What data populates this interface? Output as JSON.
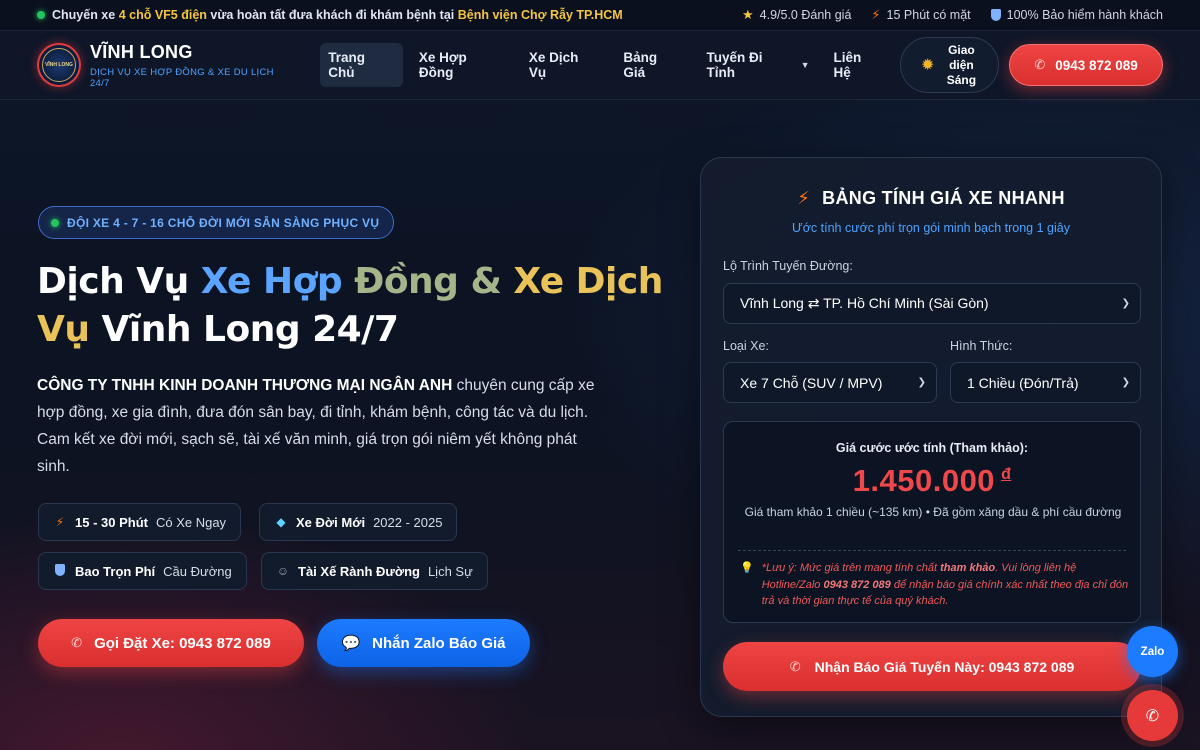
{
  "topbar": {
    "news_prefix": "Chuyến xe",
    "news_hl1": "4 chỗ VF5 điện",
    "news_mid": "vừa hoàn tất đưa khách đi khám bệnh tại",
    "news_hl2": "Bệnh viện Chợ Rẫy TP.HCM",
    "stats": [
      {
        "icon": "star-icon",
        "text": "4.9/5.0 Đánh giá"
      },
      {
        "icon": "bolt-icon",
        "text": "15 Phút có mặt"
      },
      {
        "icon": "shield-icon",
        "text": "100% Bảo hiểm hành khách"
      }
    ]
  },
  "header": {
    "logo_text": "VĨNH LONG",
    "brand_name": "VĨNH LONG",
    "brand_tagline": "DỊCH VỤ XE HỢP ĐỒNG & XE DU LỊCH 24/7",
    "nav": [
      {
        "label": "Trang Chủ",
        "active": true
      },
      {
        "label": "Xe Hợp Đồng"
      },
      {
        "label": "Xe Dịch Vụ"
      },
      {
        "label": "Bảng Giá"
      },
      {
        "label": "Tuyến Đi Tỉnh",
        "dropdown": true
      },
      {
        "label": "Liên Hệ"
      }
    ],
    "theme_toggle": "Giao diện Sáng",
    "phone": "0943 872 089"
  },
  "hero": {
    "badge": "ĐỘI XE 4 - 7 - 16 CHỖ ĐỜI MỚI SẴN SÀNG PHỤC VỤ",
    "title_1": "Dịch Vụ ",
    "title_2": "Xe Hợp",
    "title_3": " Đồng",
    "title_4": " & ",
    "title_5": "Xe Dịch",
    "title_6": "Vụ",
    "title_7": " Vĩnh Long 24/7",
    "company": "CÔNG TY TNHH KINH DOANH THƯƠNG MẠI NGÂN ANH",
    "description": " chuyên cung cấp xe hợp đồng, xe gia đình, đưa đón sân bay, đi tỉnh, khám bệnh, công tác và du lịch. Cam kết xe đời mới, sạch sẽ, tài xế văn minh, giá trọn gói niêm yết không phát sinh.",
    "features": [
      {
        "icon": "bolt-icon",
        "bold": "15 - 30 Phút",
        "text": "Có Xe Ngay"
      },
      {
        "icon": "diamond-icon",
        "bold": "Xe Đời Mới",
        "text": "2022 - 2025"
      },
      {
        "icon": "shield-icon",
        "bold": "Bao Trọn Phí",
        "text": "Cầu Đường"
      },
      {
        "icon": "driver-icon",
        "bold": "Tài Xế Rành Đường",
        "text": "Lịch Sự"
      }
    ],
    "cta_call": "Gọi Đặt Xe: 0943 872 089",
    "cta_zalo": "Nhắn Zalo Báo Giá"
  },
  "calculator": {
    "title": "BẢNG TÍNH GIÁ XE NHANH",
    "subtitle": "Ước tính cước phí trọn gói minh bạch trong 1 giây",
    "route_label": "Lộ Trình Tuyến Đường:",
    "route_value": "Vĩnh Long ⇄ TP. Hồ Chí Minh (Sài Gòn)",
    "vehicle_label": "Loại Xe:",
    "vehicle_value": "Xe 7 Chỗ (SUV / MPV)",
    "mode_label": "Hình Thức:",
    "mode_value": "1 Chiều (Đón/Trả)",
    "result_label": "Giá cước ước tính (Tham khảo):",
    "price": "1.450.000",
    "currency": "đ",
    "price_note": "Giá tham khảo 1 chiều (~135 km) • Đã gồm xăng dầu & phí cầu đường",
    "warn_1": "*Lưu ý: Mức giá trên mang tính chất ",
    "warn_b1": "tham khảo",
    "warn_2": ". Vui lòng liên hệ Hotline/Zalo ",
    "warn_b2": "0943 872 089",
    "warn_3": " để nhận báo giá chính xác nhất theo địa chỉ đón trả và thời gian thực tế của quý khách.",
    "cta": "Nhận Báo Giá Tuyến Này: 0943 872 089"
  },
  "floating": {
    "zalo": "Zalo"
  },
  "colors": {
    "accent_red": "#ef4444",
    "accent_blue": "#1d7bff",
    "gold": "#e9c35a",
    "background": "#0b1424"
  }
}
